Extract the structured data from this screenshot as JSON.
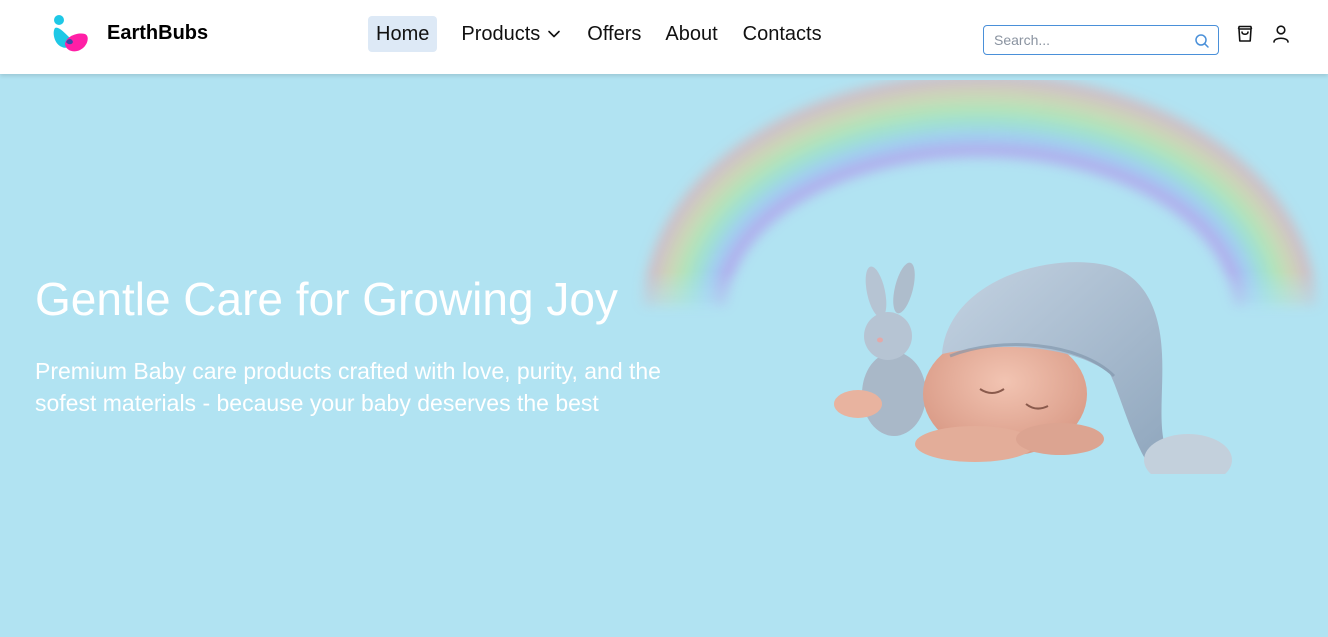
{
  "header": {
    "brand": "EarthBubs",
    "nav": {
      "home": "Home",
      "products": "Products",
      "offers": "Offers",
      "about": "About",
      "contacts": "Contacts"
    },
    "search": {
      "placeholder": "Search...",
      "value": ""
    },
    "icons": [
      "logo-icon",
      "chevron-down-icon",
      "search-icon",
      "cart-icon",
      "user-icon"
    ]
  },
  "hero": {
    "title": "Gentle Care for Growing Joy",
    "subtitle": "Premium Baby care products crafted with love, purity, and the sofest materials - because your baby deserves the best"
  },
  "colors": {
    "hero_bg": "#b1e3f2",
    "nav_active_bg": "#dde9f6",
    "search_border": "#4a90d9",
    "logo_cyan": "#1ec8e6",
    "logo_magenta": "#ff1fa6"
  }
}
